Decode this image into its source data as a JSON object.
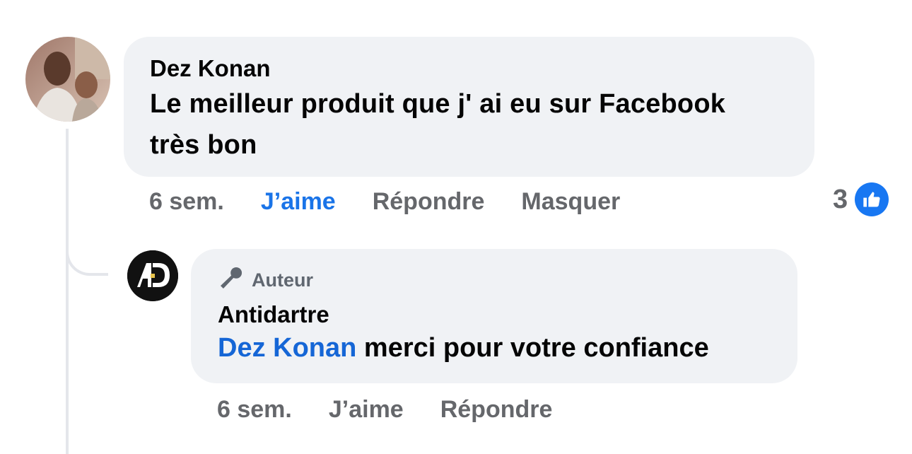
{
  "comment": {
    "author": "Dez Konan",
    "text_line1": "Le meilleur produit que j' ai eu sur Facebook",
    "text_line2": "très bon",
    "time": "6 sem.",
    "like_label": "J’aime",
    "reply_label": "Répondre",
    "hide_label": "Masquer",
    "reaction_count": "3",
    "reaction_icon": "thumbs-up-icon"
  },
  "reply": {
    "badge_icon": "microphone-icon",
    "badge_label": "Auteur",
    "author": "Antidartre",
    "mention": "Dez Konan",
    "text": "merci pour votre confiance",
    "time": "6 sem.",
    "like_label": "J’aime",
    "reply_label": "Répondre"
  },
  "colors": {
    "bubble": "#f0f2f5",
    "secondary_text": "#65676b",
    "link_blue": "#1566d6",
    "like_active": "#1a74e8",
    "reaction_blue": "#1877f2"
  }
}
